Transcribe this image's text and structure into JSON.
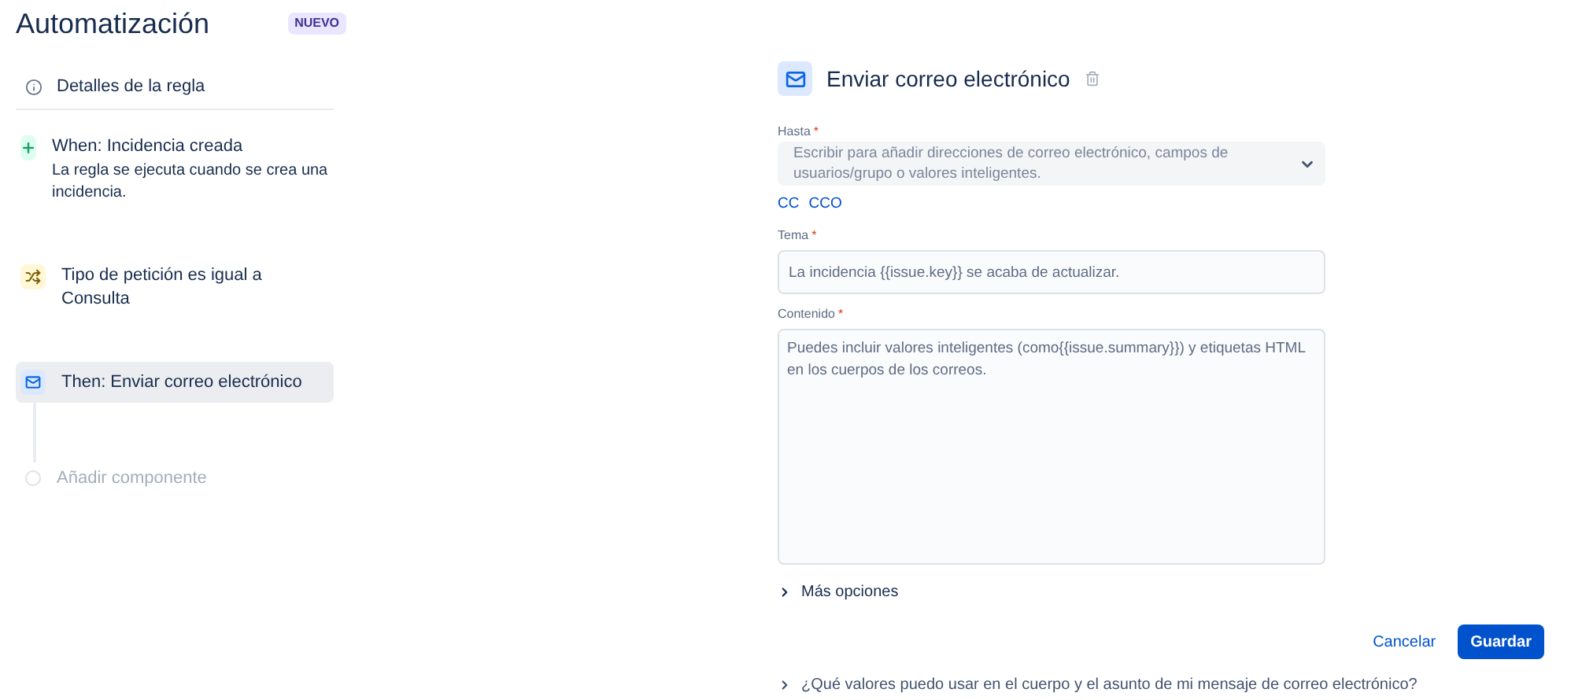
{
  "header": {
    "title": "Automatización",
    "badge": "NUEVO"
  },
  "details": {
    "label": "Detalles de la regla"
  },
  "steps": [
    {
      "kind": "trigger",
      "title": "When: Incidencia creada",
      "description": "La regla se ejecuta cuando se crea una incidencia.",
      "selected": false
    },
    {
      "kind": "condition",
      "title": "Tipo de petición es igual a Consulta",
      "selected": false
    },
    {
      "kind": "action",
      "title": "Then: Enviar correo electrónico",
      "selected": true
    },
    {
      "kind": "add",
      "title": "Añadir componente",
      "selected": false
    }
  ],
  "form": {
    "title": "Enviar correo electrónico",
    "to": {
      "label": "Hasta",
      "required_mark": "*",
      "placeholder": "Escribir para añadir direcciones de correo electrónico, campos de usuarios/grupo o valores inteligentes."
    },
    "links": [
      "CC",
      "CCO"
    ],
    "subject": {
      "label": "Tema",
      "required_mark": "*",
      "placeholder": "La incidencia {{issue.key}} se acaba de actualizar."
    },
    "body": {
      "label": "Contenido",
      "required_mark": "*",
      "placeholder": "Puedes incluir valores inteligentes (como{{issue.summary}}) y etiquetas HTML en los cuerpos de los correos."
    },
    "more_options": {
      "label": "Más opciones",
      "expanded": false
    },
    "cancel": "Cancelar",
    "save": "Guardar",
    "help": {
      "label": "¿Qué valores puedo usar en el cuerpo y el asunto de mi mensaje de correo electrónico?",
      "expanded": false
    }
  }
}
